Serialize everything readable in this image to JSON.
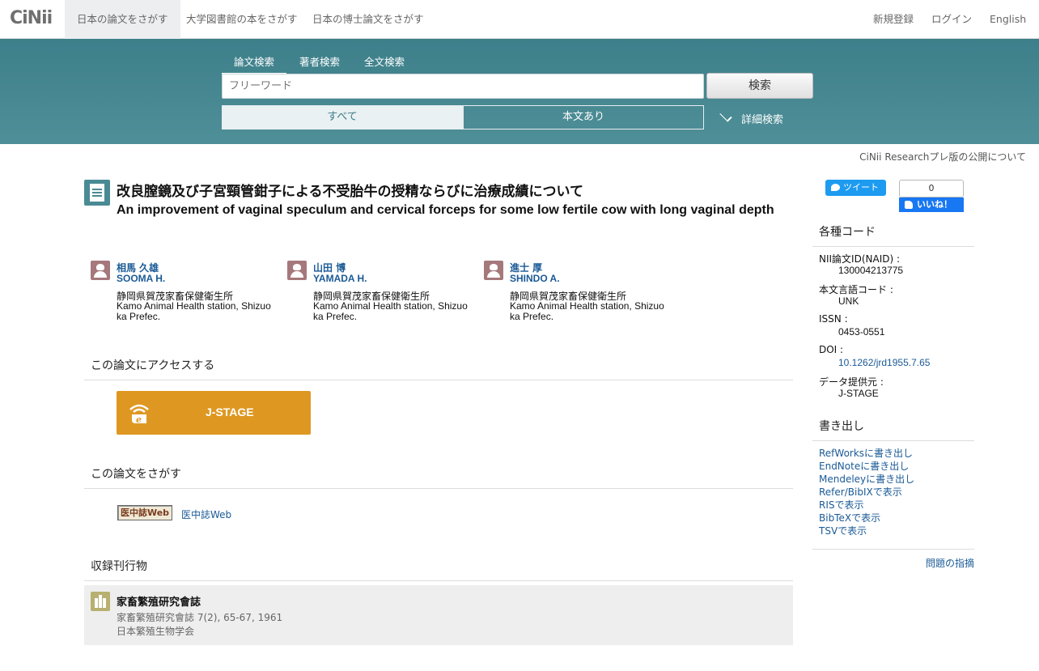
{
  "header": {
    "logo": "CiNii",
    "tabs": [
      "日本の論文をさがす",
      "大学図書館の本をさがす",
      "日本の博士論文をさがす"
    ],
    "links": [
      "新規登録",
      "ログイン",
      "English"
    ]
  },
  "search": {
    "tabs": [
      "論文検索",
      "著者検索",
      "全文検索"
    ],
    "placeholder": "フリーワード",
    "button": "検索",
    "filters": [
      "すべて",
      "本文あり"
    ],
    "advanced": "詳細検索"
  },
  "notice": "CiNii Researchプレ版の公開について",
  "article": {
    "title_ja": "改良膣鏡及び子宮頸管鉗子による不受胎牛の授精ならびに治療成績について",
    "title_en": "An improvement of vaginal speculum and cervical forceps for some low fertile cow with long vaginal depth",
    "authors": [
      {
        "name_ja": "相馬 久雄",
        "name_en": "SOOMA H.",
        "aff_ja": "静岡県賀茂家畜保健衛生所",
        "aff_en": "Kamo Animal Health station, Shizuoka Prefec."
      },
      {
        "name_ja": "山田 博",
        "name_en": "YAMADA H.",
        "aff_ja": "静岡県賀茂家畜保健衛生所",
        "aff_en": "Kamo Animal Health station, Shizuoka Prefec."
      },
      {
        "name_ja": "進士 厚",
        "name_en": "SHINDO A.",
        "aff_ja": "静岡県賀茂家畜保健衛生所",
        "aff_en": "Kamo Animal Health station, Shizuoka Prefec."
      }
    ]
  },
  "access": {
    "heading": "この論文にアクセスする",
    "jstage_label": "J-STAGE"
  },
  "find": {
    "heading": "この論文をさがす",
    "badge": "医中誌Web",
    "link": "医中誌Web"
  },
  "journal": {
    "heading": "収録刊行物",
    "title": "家畜繁殖研究會誌",
    "citation": "家畜繁殖研究會誌 7(2), 65-67, 1961",
    "publisher": "日本繁殖生物学会"
  },
  "social": {
    "tweet": "ツイート",
    "fb_count": "0",
    "fb_like": "いいね！"
  },
  "codes": {
    "heading": "各種コード",
    "items": [
      {
        "label": "NII論文ID(NAID) :",
        "value": "130004213775"
      },
      {
        "label": "本文言語コード :",
        "value": "UNK"
      },
      {
        "label": "ISSN :",
        "value": "0453-0551"
      },
      {
        "label": "DOI :",
        "value": "10.1262/jrd1955.7.65"
      },
      {
        "label": "データ提供元 :",
        "value": "J-STAGE"
      }
    ]
  },
  "export": {
    "heading": "書き出し",
    "items": [
      "RefWorksに書き出し",
      "EndNoteに書き出し",
      "Mendeleyに書き出し",
      "Refer/BibIXで表示",
      "RISで表示",
      "BibTeXで表示",
      "TSVで表示"
    ]
  },
  "report_issue": "問題の指摘",
  "colors": {
    "band": "#4a8a94",
    "jstage": "#de9822",
    "link": "#1a5a96",
    "avatar": "#a5787c"
  }
}
